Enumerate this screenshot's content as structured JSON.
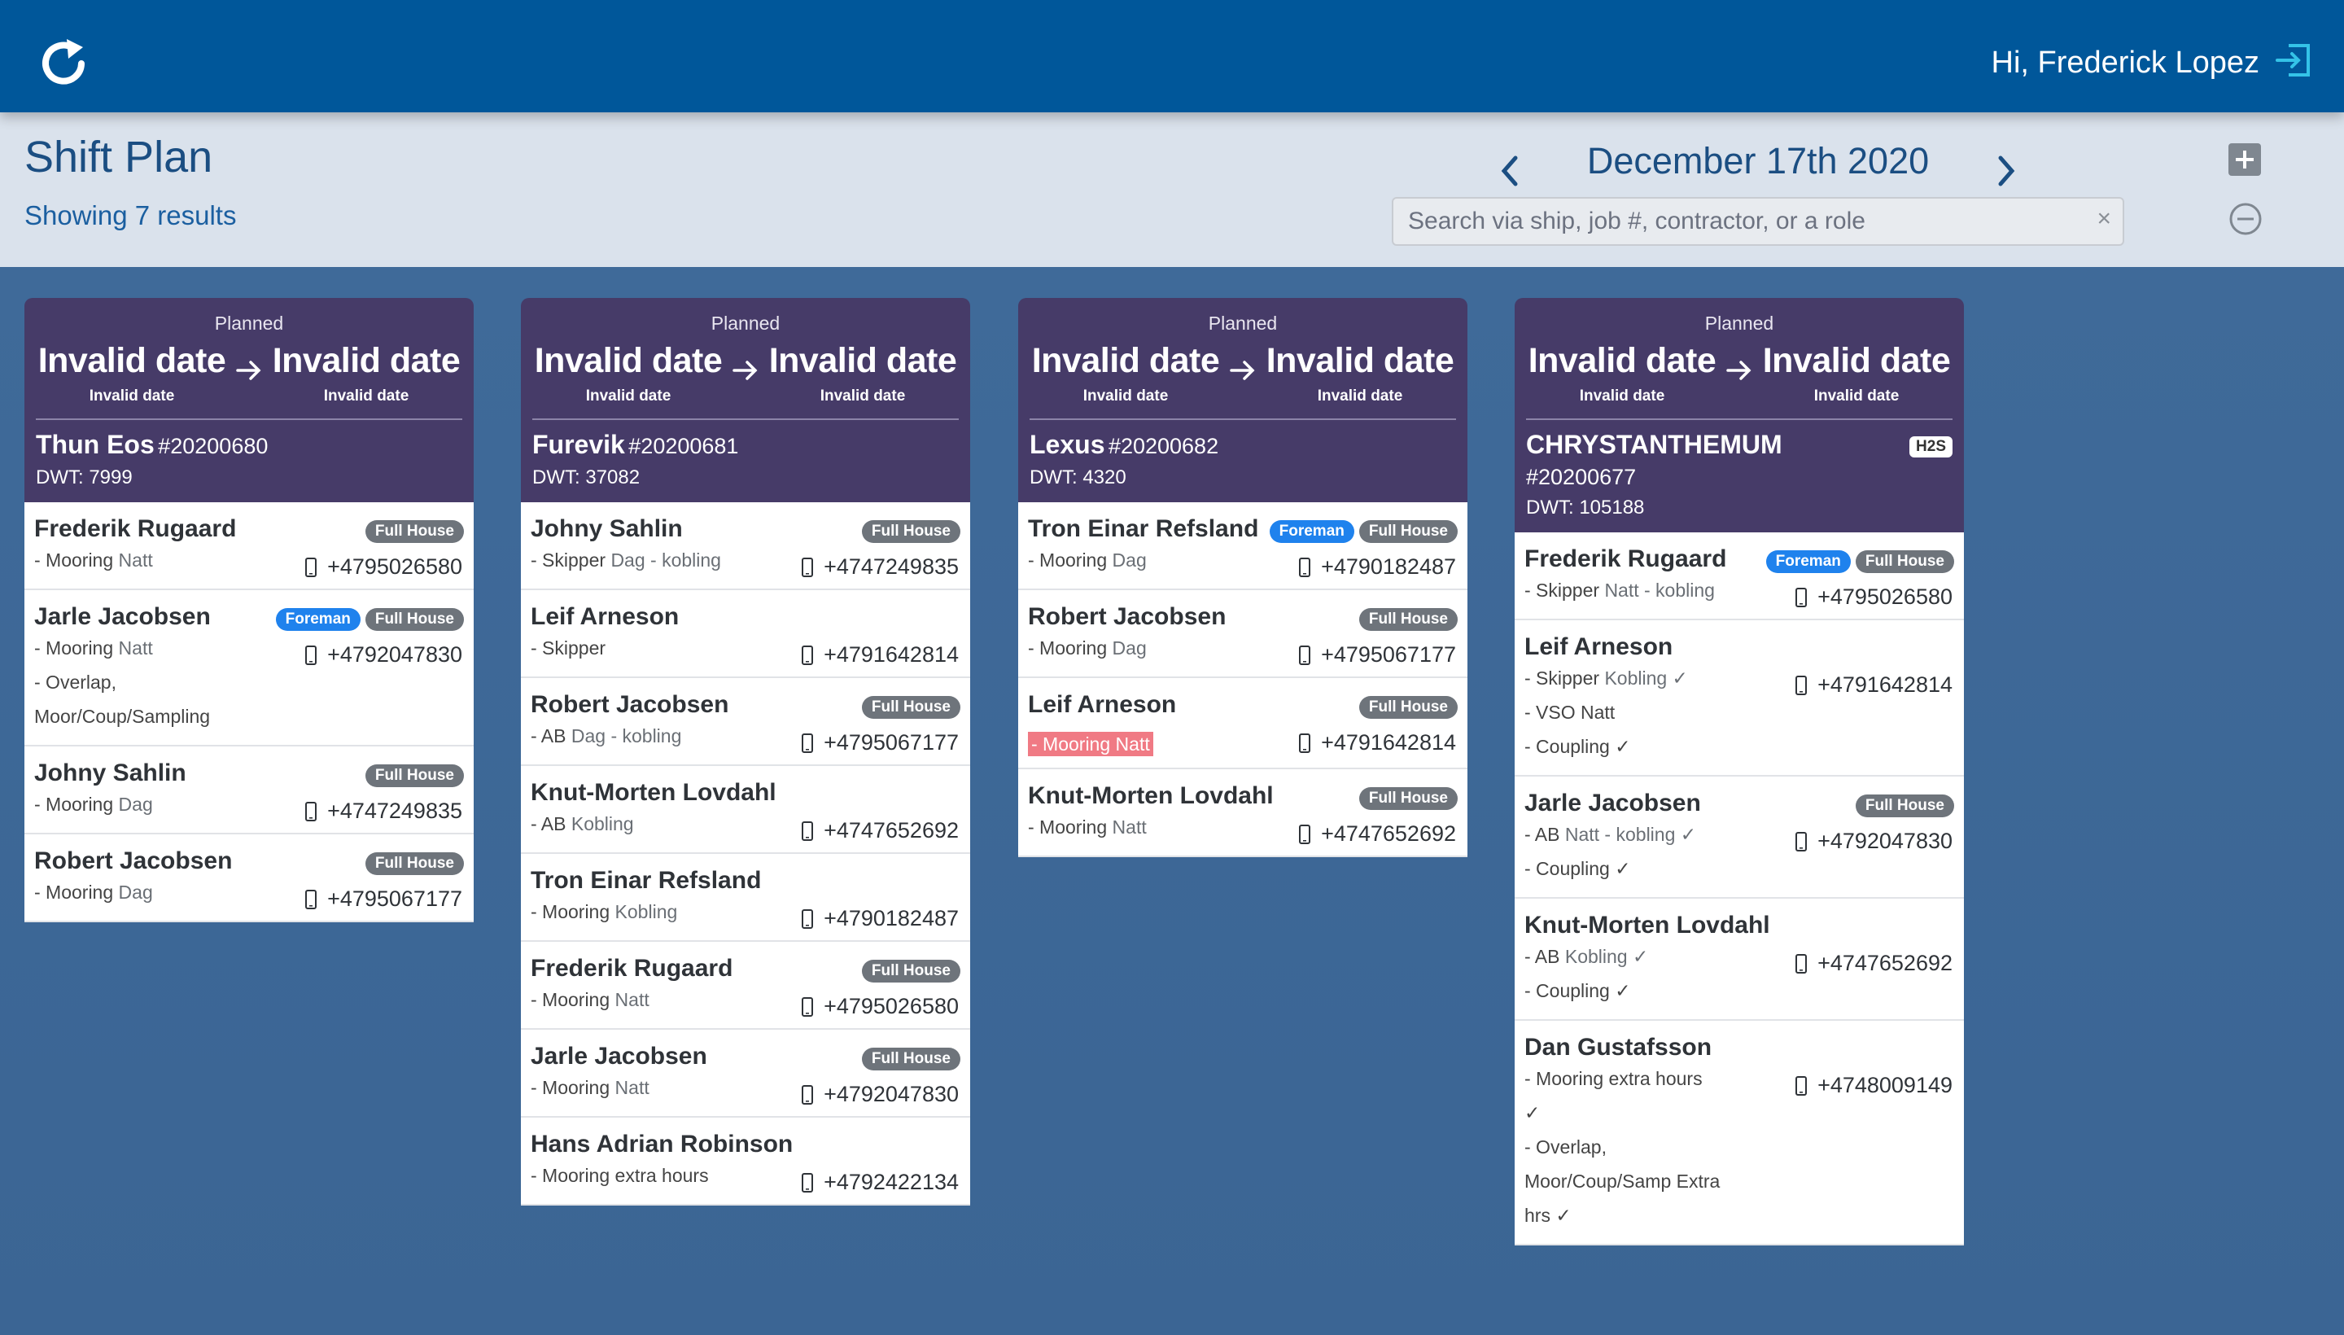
{
  "topbar": {
    "greeting": "Hi, Frederick Lopez"
  },
  "header": {
    "title": "Shift Plan",
    "results": "Showing 7 results",
    "date": "December 17th 2020",
    "search_placeholder": "Search via ship, job #, contractor, or a role",
    "clear": "×"
  },
  "cards": [
    {
      "status": "Planned",
      "start_big": "Invalid date",
      "start_small": "Invalid date",
      "end_big": "Invalid date",
      "end_small": "Invalid date",
      "ship": "Thun Eos",
      "job": "#20200680",
      "dwt": "DWT: 7999",
      "workers": [
        {
          "name": "Frederik Rugaard",
          "badges": [
            "Full House"
          ],
          "role": "- Mooring",
          "shift": "Natt",
          "phone": "+4795026580"
        },
        {
          "name": "Jarle Jacobsen",
          "badges": [
            "Foreman",
            "Full House"
          ],
          "role": "- Mooring",
          "shift": "Natt",
          "extra1": "- Overlap,",
          "extra2": "Moor/Coup/Sampling",
          "phone": "+4792047830"
        },
        {
          "name": "Johny Sahlin",
          "badges": [
            "Full House"
          ],
          "role": "- Mooring",
          "shift": "Dag",
          "phone": "+4747249835"
        },
        {
          "name": "Robert Jacobsen",
          "badges": [
            "Full House"
          ],
          "role": "- Mooring",
          "shift": "Dag",
          "phone": "+4795067177"
        }
      ]
    },
    {
      "status": "Planned",
      "start_big": "Invalid date",
      "start_small": "Invalid date",
      "end_big": "Invalid date",
      "end_small": "Invalid date",
      "ship": "Furevik",
      "job": "#20200681",
      "dwt": "DWT: 37082",
      "workers": [
        {
          "name": "Johny Sahlin",
          "badges": [
            "Full House"
          ],
          "role": "- Skipper",
          "shift": "Dag - kobling",
          "phone": "+4747249835"
        },
        {
          "name": "Leif Arneson",
          "badges": [],
          "role": "- Skipper",
          "shift": "",
          "phone": "+4791642814"
        },
        {
          "name": "Robert Jacobsen",
          "badges": [
            "Full House"
          ],
          "role": "- AB",
          "shift": "Dag - kobling",
          "phone": "+4795067177"
        },
        {
          "name": "Knut-Morten Lovdahl",
          "badges": [],
          "role": "- AB",
          "shift": "Kobling",
          "phone": "+4747652692"
        },
        {
          "name": "Tron Einar Refsland",
          "badges": [],
          "role": "- Mooring",
          "shift": "Kobling",
          "phone": "+4790182487"
        },
        {
          "name": "Frederik Rugaard",
          "badges": [
            "Full House"
          ],
          "role": "- Mooring",
          "shift": "Natt",
          "phone": "+4795026580"
        },
        {
          "name": "Jarle Jacobsen",
          "badges": [
            "Full House"
          ],
          "role": "- Mooring",
          "shift": "Natt",
          "phone": "+4792047830"
        },
        {
          "name": "Hans Adrian Robinson",
          "badges": [],
          "role": "- Mooring extra hours",
          "shift": "",
          "phone": "+4792422134"
        }
      ]
    },
    {
      "status": "Planned",
      "start_big": "Invalid date",
      "start_small": "Invalid date",
      "end_big": "Invalid date",
      "end_small": "Invalid date",
      "ship": "Lexus",
      "job": "#20200682",
      "dwt": "DWT: 4320",
      "workers": [
        {
          "name": "Tron Einar Refsland",
          "badges": [
            "Foreman",
            "Full House"
          ],
          "role": "- Mooring",
          "shift": "Dag",
          "phone": "+4790182487"
        },
        {
          "name": "Robert Jacobsen",
          "badges": [
            "Full House"
          ],
          "role": "- Mooring",
          "shift": "Dag",
          "phone": "+4795067177"
        },
        {
          "name": "Leif Arneson",
          "badges": [
            "Full House"
          ],
          "role": "- Mooring",
          "shift": "Natt",
          "alert": true,
          "phone": "+4791642814"
        },
        {
          "name": "Knut-Morten Lovdahl",
          "badges": [
            "Full House"
          ],
          "role": "- Mooring",
          "shift": "Natt",
          "phone": "+4747652692"
        }
      ]
    },
    {
      "status": "Planned",
      "start_big": "Invalid date",
      "start_small": "Invalid date",
      "end_big": "Invalid date",
      "end_small": "Invalid date",
      "ship": "CHRYSTANTHEMUM",
      "job": "#20200677",
      "dwt": "DWT: 105188",
      "tag": "H2S",
      "workers": [
        {
          "name": "Frederik Rugaard",
          "badges": [
            "Foreman",
            "Full House"
          ],
          "role": "- Skipper",
          "shift": "Natt - kobling",
          "phone": "+4795026580"
        },
        {
          "name": "Leif Arneson",
          "badges": [],
          "role": "- Skipper",
          "shift": "Kobling ✓",
          "extra1": "- VSO Natt",
          "extra2": "- Coupling ✓",
          "phone": "+4791642814"
        },
        {
          "name": "Jarle Jacobsen",
          "badges": [
            "Full House"
          ],
          "role": "- AB",
          "shift": "Natt - kobling ✓",
          "extra1": "- Coupling ✓",
          "phone": "+4792047830"
        },
        {
          "name": "Knut-Morten Lovdahl",
          "badges": [],
          "role": "- AB",
          "shift": "Kobling ✓",
          "extra1": "- Coupling ✓",
          "phone": "+4747652692"
        },
        {
          "name": "Dan Gustafsson",
          "badges": [],
          "role": "- Mooring extra hours",
          "shift": "",
          "extra1": "✓",
          "extra2": "- Overlap,",
          "extra3": "Moor/Coup/Samp Extra",
          "extra4": "hrs ✓",
          "phone": "+4748009149"
        }
      ]
    }
  ]
}
